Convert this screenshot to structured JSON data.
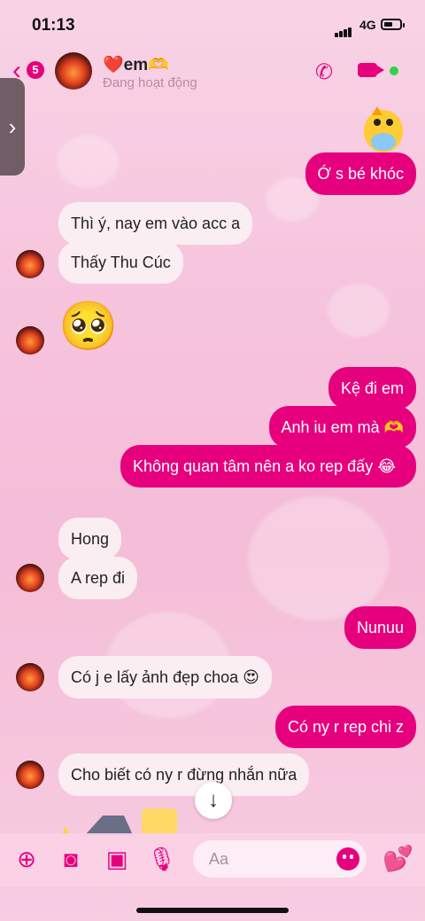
{
  "status": {
    "time": "01:13",
    "network": "4G"
  },
  "header": {
    "back_count": "5",
    "name": "❤️em🫶",
    "status": "Đang hoạt động"
  },
  "messages": [
    {
      "side": "out",
      "text": "Ớ s bé khóc"
    },
    {
      "side": "in",
      "text": "Thì ý, nay em vào acc a"
    },
    {
      "side": "in",
      "text": "Thấy Thu Cúc"
    },
    {
      "side": "in",
      "text": "🥺"
    },
    {
      "side": "out",
      "text": "Kệ đi em"
    },
    {
      "side": "out",
      "text": "Anh iu em mà 🫶"
    },
    {
      "side": "out",
      "text": "Không quan tâm nên a ko rep đấy 😂"
    },
    {
      "side": "in",
      "text": "Hong"
    },
    {
      "side": "in",
      "text": "A rep đi"
    },
    {
      "side": "out",
      "text": "Nunuu"
    },
    {
      "side": "in",
      "text": "Có j e lấy ảnh đẹp choa 😍"
    },
    {
      "side": "out",
      "text": "Có ny r rep chi z"
    },
    {
      "side": "in",
      "text": "Cho biết có ny r đừng nhắn nữa"
    }
  ],
  "composer": {
    "placeholder": "Aa"
  },
  "icons": {
    "back": "chevron-left-icon",
    "phone": "phone-icon",
    "video": "video-camera-icon",
    "plus": "plus-circle-icon",
    "camera": "camera-icon",
    "image": "image-icon",
    "mic": "microphone-icon",
    "emoji": "smiley-icon",
    "like": "hearts-icon",
    "scroll": "arrow-down-icon"
  },
  "colors": {
    "accent": "#e6007e",
    "incoming_bubble": "#fbeef3",
    "online": "#2fd24a"
  }
}
